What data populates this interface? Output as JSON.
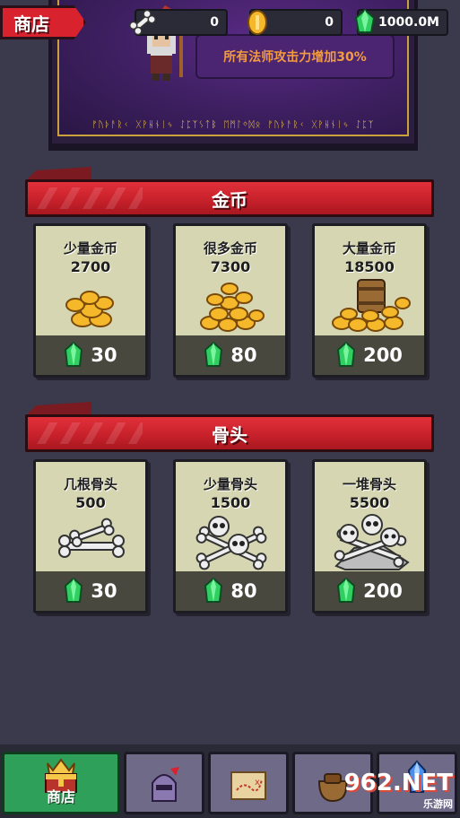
{
  "header": {
    "shop_label": "商店",
    "bones_count": "0",
    "coins_count": "0",
    "gems_count": "1000.0M",
    "bonus_text": "所有法师攻击力增加30%",
    "rune_text": "ᚠᚢᚦᚨᚱᚲ ᚷᚹᚺᚾᛁᛃ ᛇᛈᛉᛊᛏᛒ ᛖᛗᛚᛜᛞᛟ ᚠᚢᚦᚨᚱᚲ ᚷᚹᚺᚾᛁᛃ ᛇᛈᛉ"
  },
  "sections": {
    "coins": {
      "title": "金币",
      "items": [
        {
          "name": "少量金币",
          "amount": "2700",
          "price": "30"
        },
        {
          "name": "很多金币",
          "amount": "7300",
          "price": "80"
        },
        {
          "name": "大量金币",
          "amount": "18500",
          "price": "200"
        }
      ]
    },
    "bones": {
      "title": "骨头",
      "items": [
        {
          "name": "几根骨头",
          "amount": "500",
          "price": "30"
        },
        {
          "name": "少量骨头",
          "amount": "1500",
          "price": "80"
        },
        {
          "name": "一堆骨头",
          "amount": "5500",
          "price": "200"
        }
      ]
    }
  },
  "nav": {
    "shop_label": "商店",
    "tabs": [
      "shop",
      "heroes",
      "map",
      "inventory",
      "crystal"
    ]
  },
  "watermark": {
    "brand": "962.NET",
    "sub": "乐游网"
  },
  "colors": {
    "accent_red": "#d8232f",
    "gem_green": "#2fcf62",
    "coin_gold": "#f5b82a",
    "nav_active": "#2fa05a"
  },
  "icons": [
    "bone-icon",
    "coin-icon",
    "gem-icon",
    "wizard-sprite",
    "crown-chest-icon",
    "knight-helmet-icon",
    "treasure-map-icon",
    "bag-icon",
    "crystal-icon"
  ]
}
